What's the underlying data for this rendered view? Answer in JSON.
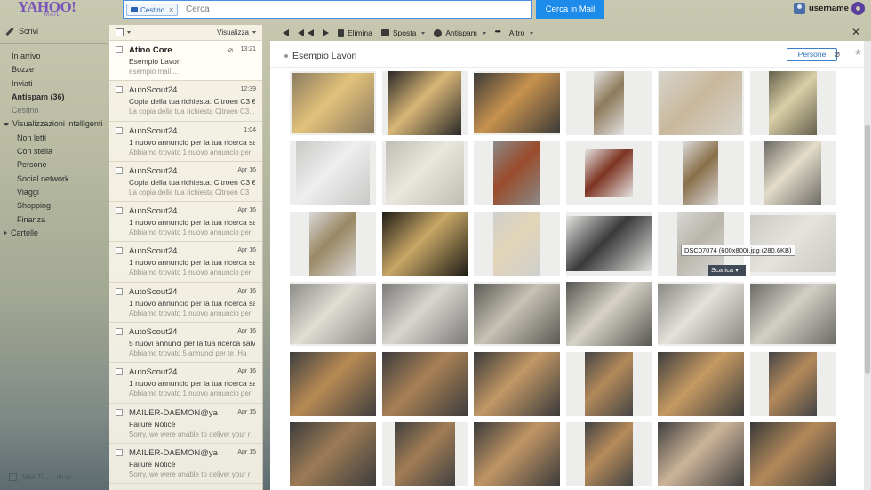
{
  "header": {
    "logo_text": "YAHOO!",
    "logo_sub": "MAIL",
    "search_chip": "Cestino",
    "search_placeholder": "Cerca",
    "search_button": "Cerca in Mail",
    "username": "username"
  },
  "nav": {
    "compose": "Scrivi",
    "items": [
      {
        "label": "In arrivo",
        "style": "l1"
      },
      {
        "label": "Bozze",
        "style": "l1"
      },
      {
        "label": "Inviati",
        "style": "l1"
      },
      {
        "label": "Antispam (36)",
        "style": "l1 bold"
      },
      {
        "label": "Cestino",
        "style": "l1 muted"
      },
      {
        "label": "Visualizzazioni intelligenti",
        "style": "l0",
        "caret": "down"
      },
      {
        "label": "Non letti",
        "style": "l2"
      },
      {
        "label": "Con stella",
        "style": "l2"
      },
      {
        "label": "Persone",
        "style": "l2"
      },
      {
        "label": "Social network",
        "style": "l2"
      },
      {
        "label": "Viaggi",
        "style": "l2"
      },
      {
        "label": "Shopping",
        "style": "l2"
      },
      {
        "label": "Finanza",
        "style": "l2"
      },
      {
        "label": "Cartelle",
        "style": "l0",
        "caret": "right"
      }
    ],
    "footer": "Mail Ti... ...ificar"
  },
  "list": {
    "view_label": "Visualizza",
    "messages": [
      {
        "from": "Atino Core",
        "date": "13:21",
        "subject": "Esempio Lavori",
        "snippet": "esempio mail ...",
        "unread": true,
        "attachment": true
      },
      {
        "from": "AutoScout24",
        "date": "12:39",
        "subject": "Copia della tua richiesta: Citroen C3 € 2",
        "snippet": "La copia della tua richiesta Citroen C3..."
      },
      {
        "from": "AutoScout24",
        "date": "1:04",
        "subject": "1 nuovo annuncio per la tua ricerca sal",
        "snippet": "Abbiamo trovato 1 nuovo annuncio per"
      },
      {
        "from": "AutoScout24",
        "date": "Apr 16",
        "subject": "Copia della tua richiesta: Citroen C3 € 2",
        "snippet": "La copia della tua richiesta Citroen C3"
      },
      {
        "from": "AutoScout24",
        "date": "Apr 16",
        "subject": "1 nuovo annuncio per la tua ricerca sal",
        "snippet": "Abbiamo trovato 1 nuovo annuncio per"
      },
      {
        "from": "AutoScout24",
        "date": "Apr 16",
        "subject": "1 nuovo annuncio per la tua ricerca sal",
        "snippet": "Abbiamo trovato 1 nuovo annuncio per"
      },
      {
        "from": "AutoScout24",
        "date": "Apr 16",
        "subject": "1 nuovo annuncio per la tua ricerca sal",
        "snippet": "Abbiamo trovato 1 nuovo annuncio per"
      },
      {
        "from": "AutoScout24",
        "date": "Apr 16",
        "subject": "5 nuovi annunci per la tua ricerca salva",
        "snippet": "Abbiamo trovato 5 annunci per te. Ha"
      },
      {
        "from": "AutoScout24",
        "date": "Apr 16",
        "subject": "1 nuovo annuncio per la tua ricerca sal",
        "snippet": "Abbiamo trovato 1 nuovo annuncio per"
      },
      {
        "from": "MAILER-DAEMON@yaho",
        "date": "Apr 15",
        "subject": "Failure Notice",
        "snippet": "Sorry, we were unable to deliver your r"
      },
      {
        "from": "MAILER-DAEMON@yaho",
        "date": "Apr 15",
        "subject": "Failure Notice",
        "snippet": "Sorry, we were unable to deliver your r"
      }
    ]
  },
  "toolbar": {
    "delete": "Elimina",
    "move": "Sposta",
    "spam": "Antispam",
    "more": "Altro"
  },
  "reader": {
    "subject": "Esempio Lavori",
    "persone_button": "Persone",
    "tooltip": "DSC07074 (600x800).jpg (280,6KB)",
    "download": "Scarica"
  },
  "colors": {
    "accent": "#1c8bea",
    "brand": "#7a56b8"
  },
  "thumbnails": [
    {
      "bg": "#8a7a60",
      "fg": "#e2c27a",
      "w": 0.95,
      "h": 0.95
    },
    {
      "bg": "#2a2a28",
      "fg": "#d8b676",
      "w": 0.85,
      "h": 1.0
    },
    {
      "bg": "#3b3a38",
      "fg": "#c8924e",
      "w": 1.0,
      "h": 0.95
    },
    {
      "bg": "#e2e2e2",
      "fg": "#8f7a5a",
      "w": 0.35,
      "h": 1.0
    },
    {
      "bg": "#d7d4cc",
      "fg": "#c9b89c",
      "w": 0.95,
      "h": 1.0
    },
    {
      "bg": "#66604d",
      "fg": "#d9cfa7",
      "w": 0.55,
      "h": 1.0
    },
    {
      "bg": "#c8c8c6",
      "fg": "#eeeeee",
      "w": 0.85,
      "h": 1.0
    },
    {
      "bg": "#c0bdb5",
      "fg": "#e9e6de",
      "w": 0.9,
      "h": 1.0
    },
    {
      "bg": "#8a8a88",
      "fg": "#9a4b2c",
      "w": 0.55,
      "h": 1.0
    },
    {
      "bg": "#e4e4e2",
      "fg": "#7e3322",
      "w": 0.55,
      "h": 0.75
    },
    {
      "bg": "#dadad8",
      "fg": "#8a6f4a",
      "w": 0.4,
      "h": 1.0
    },
    {
      "bg": "#6c6a66",
      "fg": "#e3dcc8",
      "w": 0.65,
      "h": 1.0
    },
    {
      "bg": "#d9d9d7",
      "fg": "#9a8764",
      "w": 0.55,
      "h": 1.0
    },
    {
      "bg": "#1f1c16",
      "fg": "#c8a766",
      "w": 1.0,
      "h": 1.0
    },
    {
      "bg": "#cfcfcd",
      "fg": "#e3d6b8",
      "w": 0.55,
      "h": 1.0
    },
    {
      "bg": "#e2e2e0",
      "fg": "#3a3a3a",
      "w": 1.0,
      "h": 0.85
    },
    {
      "bg": "#d8d8d6",
      "fg": "#b9b5aa",
      "w": 0.55,
      "h": 1.0
    },
    {
      "bg": "#c9c8c2",
      "fg": "#e5e3dc",
      "w": 1.0,
      "h": 0.9
    },
    {
      "bg": "#8d8c88",
      "fg": "#e0ddd4",
      "w": 1.0,
      "h": 0.95
    },
    {
      "bg": "#7c7b78",
      "fg": "#d8d6d0",
      "w": 1.0,
      "h": 0.95
    },
    {
      "bg": "#5b5a55",
      "fg": "#c7c2b5",
      "w": 1.0,
      "h": 0.95
    },
    {
      "bg": "#585651",
      "fg": "#d6d2c8",
      "w": 1.0,
      "h": 1.0
    },
    {
      "bg": "#8a8883",
      "fg": "#e3e1da",
      "w": 1.0,
      "h": 0.95
    },
    {
      "bg": "#6d6b66",
      "fg": "#d2cfc6",
      "w": 1.0,
      "h": 0.95
    },
    {
      "bg": "#3f3f3f",
      "fg": "#b88a54",
      "w": 1.0,
      "h": 1.0
    },
    {
      "bg": "#3c3c3c",
      "fg": "#a88055",
      "w": 1.0,
      "h": 1.0
    },
    {
      "bg": "#3a3a3a",
      "fg": "#c29866",
      "w": 1.0,
      "h": 1.0
    },
    {
      "bg": "#454545",
      "fg": "#b2895a",
      "w": 0.55,
      "h": 1.0
    },
    {
      "bg": "#3e3e3e",
      "fg": "#c69a62",
      "w": 1.0,
      "h": 1.0
    },
    {
      "bg": "#444444",
      "fg": "#b4895c",
      "w": 0.55,
      "h": 1.0
    },
    {
      "bg": "#3d3d3d",
      "fg": "#9c7b55",
      "w": 1.0,
      "h": 1.0
    },
    {
      "bg": "#404040",
      "fg": "#a27d55",
      "w": 0.7,
      "h": 1.0
    },
    {
      "bg": "#3b3b3b",
      "fg": "#c09565",
      "w": 1.0,
      "h": 1.0
    },
    {
      "bg": "#424242",
      "fg": "#b78c5c",
      "w": 0.55,
      "h": 1.0
    },
    {
      "bg": "#3f3f3f",
      "fg": "#cdb498",
      "w": 1.0,
      "h": 1.0
    },
    {
      "bg": "#393939",
      "fg": "#b3895a",
      "w": 1.0,
      "h": 1.0
    }
  ]
}
